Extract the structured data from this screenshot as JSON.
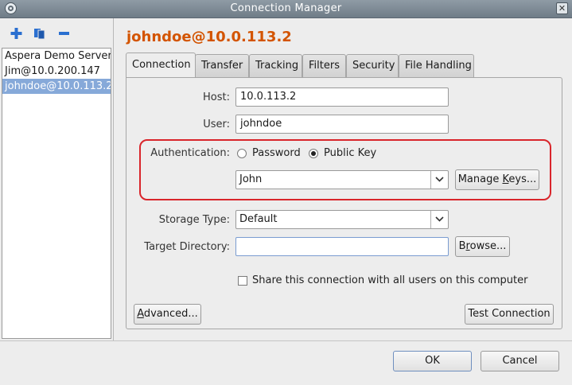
{
  "window": {
    "title": "Connection Manager"
  },
  "connections": [
    {
      "label": "Aspera Demo Server",
      "selected": false
    },
    {
      "label": "Jim@10.0.200.147",
      "selected": false
    },
    {
      "label": "johndoe@10.0.113.2",
      "selected": true
    }
  ],
  "toolbar": {
    "add_icon": "plus-icon",
    "duplicate_icon": "duplicate-icon",
    "remove_icon": "minus-icon"
  },
  "heading": "johndoe@10.0.113.2",
  "tabs": [
    {
      "label": "Connection",
      "active": true
    },
    {
      "label": "Transfer",
      "active": false
    },
    {
      "label": "Tracking",
      "active": false
    },
    {
      "label": "Filters",
      "active": false
    },
    {
      "label": "Security",
      "active": false
    },
    {
      "label": "File Handling",
      "active": false
    }
  ],
  "form": {
    "host_label": "Host:",
    "host_value": "10.0.113.2",
    "user_label": "User:",
    "user_value": "johndoe",
    "auth_label": "Authentication:",
    "auth_password": "Password",
    "auth_public_key": "Public Key",
    "auth_selected": "Public Key",
    "key_value": "John",
    "manage_keys_pre": "Manage ",
    "manage_keys_mnemonic": "K",
    "manage_keys_post": "eys...",
    "storage_label": "Storage Type:",
    "storage_value": "Default",
    "target_label": "Target Directory:",
    "target_value": "",
    "browse_pre": "B",
    "browse_mnemonic": "r",
    "browse_post": "owse...",
    "share_label": "Share this connection with all users on this computer",
    "share_checked": false,
    "advanced_pre": "",
    "advanced_mnemonic": "A",
    "advanced_post": "dvanced...",
    "test_connection": "Test Connection"
  },
  "footer": {
    "ok": "OK",
    "cancel": "Cancel"
  },
  "colors": {
    "heading": "#d35400",
    "highlight": "#d9252b",
    "selection": "#86a9d9",
    "add_icon": "#2a6fd0"
  }
}
